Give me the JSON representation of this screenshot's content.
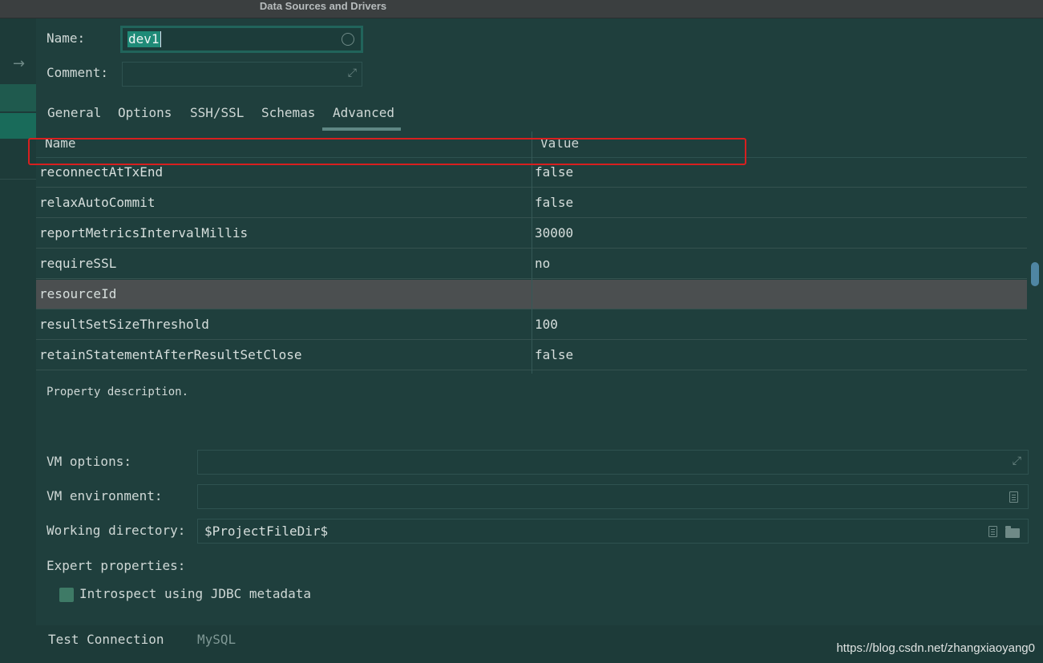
{
  "window": {
    "title": "Data Sources and Drivers"
  },
  "form": {
    "name_label": "Name:",
    "name_value": "dev1",
    "comment_label": "Comment:",
    "comment_value": ""
  },
  "tabs": [
    {
      "label": "General"
    },
    {
      "label": "Options"
    },
    {
      "label": "SSH/SSL"
    },
    {
      "label": "Schemas"
    },
    {
      "label": "Advanced",
      "selected": true
    }
  ],
  "table": {
    "headers": {
      "name": "Name",
      "value": "Value"
    },
    "rows": [
      {
        "name": "reconnectAtTxEnd",
        "value": "false"
      },
      {
        "name": "relaxAutoCommit",
        "value": "false"
      },
      {
        "name": "reportMetricsIntervalMillis",
        "value": "30000"
      },
      {
        "name": "requireSSL",
        "value": "no",
        "highlighted": true
      },
      {
        "name": "resourceId",
        "value": "",
        "selected": true
      },
      {
        "name": "resultSetSizeThreshold",
        "value": "100"
      },
      {
        "name": "retainStatementAfterResultSetClose",
        "value": "false"
      }
    ]
  },
  "description": "Property description.",
  "vm": {
    "options_label": "VM options:",
    "options_value": "",
    "environment_label": "VM environment:",
    "environment_value": "",
    "working_dir_label": "Working directory:",
    "working_dir_value": "$ProjectFileDir$"
  },
  "expert": {
    "label": "Expert properties:",
    "introspect_label": "Introspect using JDBC metadata",
    "introspect_checked": false
  },
  "footer": {
    "test_connection": "Test Connection",
    "driver_name": "MySQL"
  },
  "watermark": "https://blog.csdn.net/zhangxiaoyang0",
  "colors": {
    "background": "#1f3f3d",
    "selected_row": "#4b4f50",
    "highlight_box": "#d81f1f",
    "tab_underline": "#5e8784"
  }
}
